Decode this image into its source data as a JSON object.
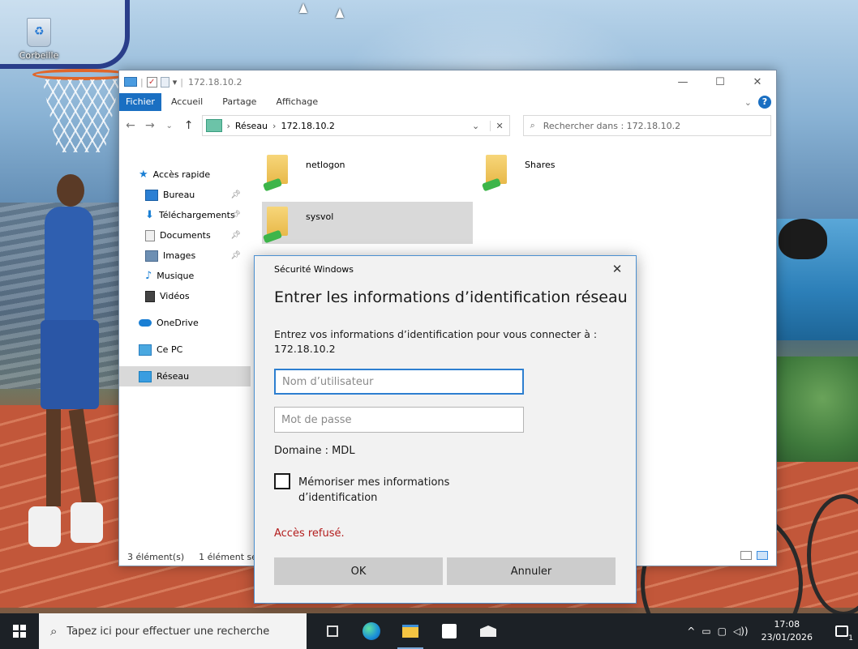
{
  "desktop": {
    "recycle_bin_label": "Corbeille"
  },
  "explorer": {
    "title": "172.18.10.2",
    "ribbon_tabs": [
      "Fichier",
      "Accueil",
      "Partage",
      "Affichage"
    ],
    "window_controls": {
      "minimize": "—",
      "maximize": "☐",
      "close": "✕"
    },
    "address": {
      "segments": [
        "Réseau",
        "172.18.10.2"
      ]
    },
    "search": {
      "placeholder": "Rechercher dans : 172.18.10.2"
    },
    "nav": {
      "quick_access": "Accès rapide",
      "items": [
        "Bureau",
        "Téléchargements",
        "Documents",
        "Images",
        "Musique",
        "Vidéos"
      ],
      "onedrive": "OneDrive",
      "this_pc": "Ce PC",
      "network": "Réseau"
    },
    "folders": [
      "netlogon",
      "Shares",
      "sysvol"
    ],
    "status": {
      "count": "3 élément(s)",
      "selected": "1 élément sé"
    }
  },
  "dialog": {
    "window_title": "Sécurité Windows",
    "heading": "Entrer les informations d’identification réseau",
    "description": "Entrez vos informations d’identification pour vous connecter à : 172.18.10.2",
    "username_placeholder": "Nom d’utilisateur",
    "password_placeholder": "Mot de passe",
    "domain": "Domaine : MDL",
    "remember_label": "Mémoriser mes informations d’identification",
    "remember_checked": false,
    "error": "Accès refusé.",
    "ok_label": "OK",
    "cancel_label": "Annuler",
    "error_color": "#b31c1c",
    "accent_color": "#2d7fd0"
  },
  "taskbar": {
    "search_placeholder": "Tapez ici pour effectuer une recherche",
    "time": "17:08",
    "date": "23/01/2026",
    "notification_count": "1"
  }
}
